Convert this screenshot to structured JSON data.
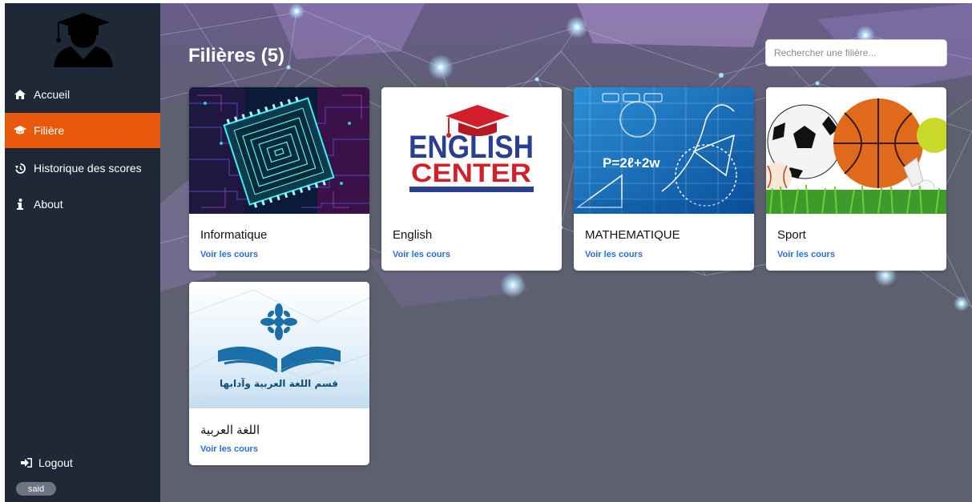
{
  "sidebar": {
    "items": [
      {
        "label": "Accueil",
        "icon": "home-icon"
      },
      {
        "label": "Filière",
        "icon": "graduation-cap-icon",
        "active": true
      },
      {
        "label": "Historique des scores",
        "icon": "history-icon"
      },
      {
        "label": "About",
        "icon": "info-icon"
      }
    ],
    "logout_label": "Logout",
    "user": "said"
  },
  "header": {
    "title": "Filières (5)"
  },
  "search": {
    "placeholder": "Rechercher une filière..."
  },
  "cards": [
    {
      "title": "Informatique",
      "link": "Voir les cours"
    },
    {
      "title": "English",
      "link": "Voir les cours",
      "image_text": [
        "ENGLISH",
        "CENTER"
      ]
    },
    {
      "title": "MATHEMATIQUE",
      "link": "Voir les cours",
      "image_text": [
        "P=2ℓ+2w"
      ]
    },
    {
      "title": "Sport",
      "link": "Voir les cours"
    },
    {
      "title": "اللغة العربية",
      "link": "Voir les cours",
      "image_text": [
        "قسم اللغة العربية وآدابها"
      ]
    }
  ],
  "colors": {
    "sidebar_bg": "#1f2836",
    "active_accent": "#e8590c",
    "link": "#2a6fd6",
    "main_bg": "#5c5e6e"
  }
}
